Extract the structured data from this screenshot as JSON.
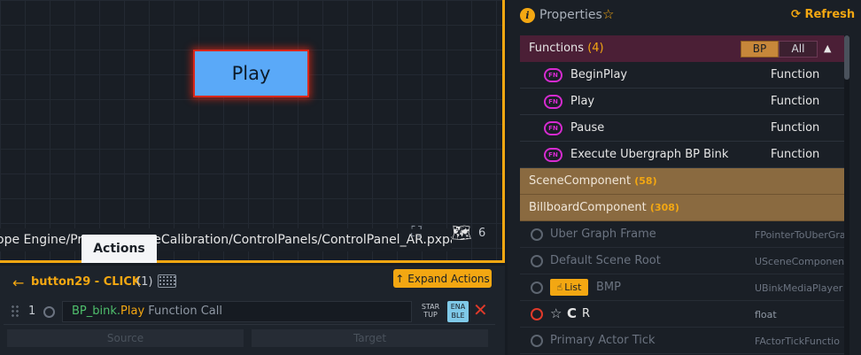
{
  "canvas": {
    "play_button_label": "Play",
    "path": "ope Engine/Pro         peCalibration/ControlPanels/ControlPanel_AR.pxpanel",
    "map_count": "6"
  },
  "tabs": {
    "actions_label": "Actions"
  },
  "actions": {
    "title": "button29 - CLICK",
    "count": "(1)",
    "expand_label": "Expand Actions",
    "row": {
      "index": "1",
      "bp": "BP_bink.",
      "fn": "Play",
      "kind": " Function Call",
      "startup_line1": "STAR",
      "startup_line2": "TUP",
      "enable_line1": "ENA",
      "enable_line2": "BLE"
    },
    "source_placeholder": "Source",
    "target_placeholder": "Target"
  },
  "properties": {
    "title": "Properties",
    "refresh_label": "Refresh",
    "functions": {
      "label": "Functions",
      "count": "(4)",
      "bp_label": "BP",
      "all_label": "All",
      "items": [
        {
          "badge": "FN",
          "name": "BeginPlay",
          "type": "Function"
        },
        {
          "badge": "FN",
          "name": "Play",
          "type": "Function"
        },
        {
          "badge": "FN",
          "name": "Pause",
          "type": "Function"
        },
        {
          "badge": "FN",
          "name": "Execute Ubergraph BP Bink",
          "type": "Function"
        }
      ]
    },
    "scene_component": {
      "label": "SceneComponent",
      "count": "(58)"
    },
    "billboard_component": {
      "label": "BillboardComponent",
      "count": "(308)"
    },
    "props": [
      {
        "name": "Uber Graph Frame",
        "type": "FPointerToUberGra"
      },
      {
        "name": "Default Scene Root",
        "type": "USceneComponen"
      },
      {
        "chip": "List",
        "name": "BMP",
        "type": "UBinkMediaPlayer"
      },
      {
        "c": "C",
        "r": "R",
        "type": "float"
      },
      {
        "name": "Primary Actor Tick",
        "type": "FActorTickFunctio"
      }
    ]
  }
}
